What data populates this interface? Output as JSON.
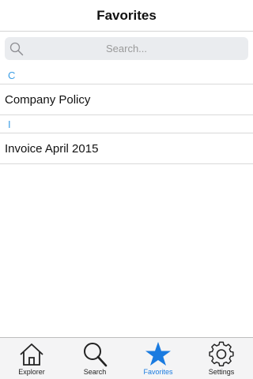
{
  "header": {
    "title": "Favorites"
  },
  "search": {
    "placeholder": "Search...",
    "icon": "search-icon"
  },
  "sections": [
    {
      "letter": "C",
      "items": [
        "Company Policy"
      ]
    },
    {
      "letter": "I",
      "items": [
        "Invoice April 2015"
      ]
    }
  ],
  "tabs": [
    {
      "label": "Explorer",
      "icon": "home-icon",
      "active": false
    },
    {
      "label": "Search",
      "icon": "magnifier-icon",
      "active": false
    },
    {
      "label": "Favorites",
      "icon": "star-icon",
      "active": true
    },
    {
      "label": "Settings",
      "icon": "gear-icon",
      "active": false
    }
  ],
  "colors": {
    "accent": "#1a7be0",
    "section_letter": "#3c9ee5"
  }
}
